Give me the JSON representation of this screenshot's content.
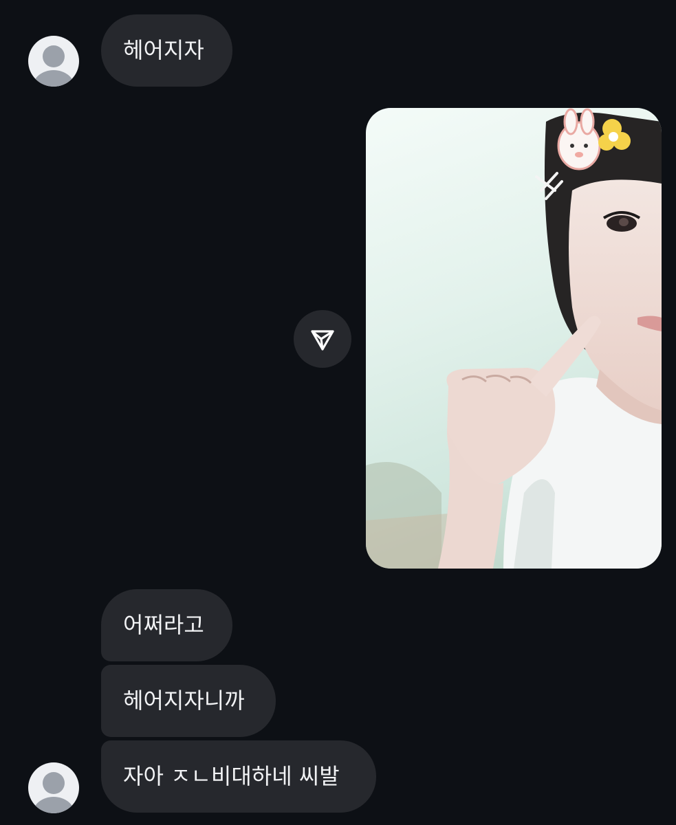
{
  "messages": [
    {
      "sender": "other",
      "text": "헤어지자"
    },
    {
      "sender": "me",
      "type": "photo"
    },
    {
      "sender": "other",
      "text": "어쩌라고"
    },
    {
      "sender": "other",
      "text": "헤어지자니까"
    },
    {
      "sender": "other",
      "text": "자아 ㅈㄴ비대하네 씨발"
    }
  ],
  "colors": {
    "background": "#0d1015",
    "bubble": "#26282d",
    "bubble_text": "#f2f3f5",
    "avatar_bg": "#eef0f3",
    "avatar_fg": "#9ba1aa"
  },
  "icons": {
    "avatar": "default-profile-icon",
    "share": "paper-plane-icon"
  }
}
